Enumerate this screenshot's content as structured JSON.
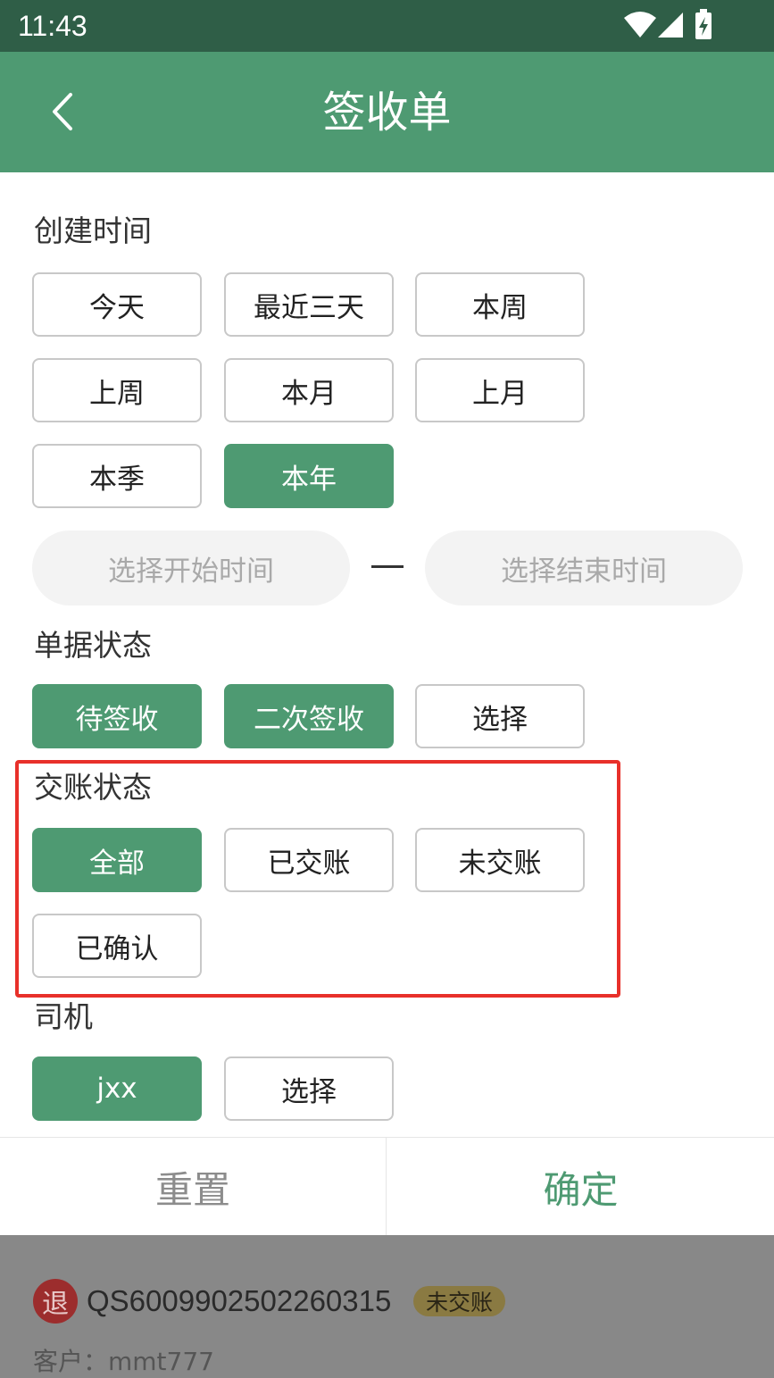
{
  "status_bar": {
    "time": "11:43"
  },
  "app_bar": {
    "title": "签收单"
  },
  "sections": {
    "created_time": {
      "label": "创建时间",
      "options": [
        "今天",
        "最近三天",
        "本周",
        "上周",
        "本月",
        "上月",
        "本季",
        "本年"
      ],
      "selected": "本年",
      "start_placeholder": "选择开始时间",
      "end_placeholder": "选择结束时间"
    },
    "doc_status": {
      "label": "单据状态",
      "options": [
        "待签收",
        "二次签收",
        "选择"
      ],
      "selected": [
        "待签收",
        "二次签收"
      ]
    },
    "settle_status": {
      "label": "交账状态",
      "options": [
        "全部",
        "已交账",
        "未交账",
        "已确认"
      ],
      "selected": "全部"
    },
    "driver": {
      "label": "司机",
      "options": [
        "jxx",
        "选择"
      ],
      "selected": "jxx"
    }
  },
  "actions": {
    "reset": "重置",
    "confirm": "确定"
  },
  "background_item": {
    "badge": "退",
    "order_no": "QS6009902502260315",
    "status": "未交账",
    "customer": "客户：mmt777"
  },
  "colors": {
    "status_bar": "#2f5e47",
    "primary": "#4e9a72",
    "highlight": "#e8302a"
  }
}
